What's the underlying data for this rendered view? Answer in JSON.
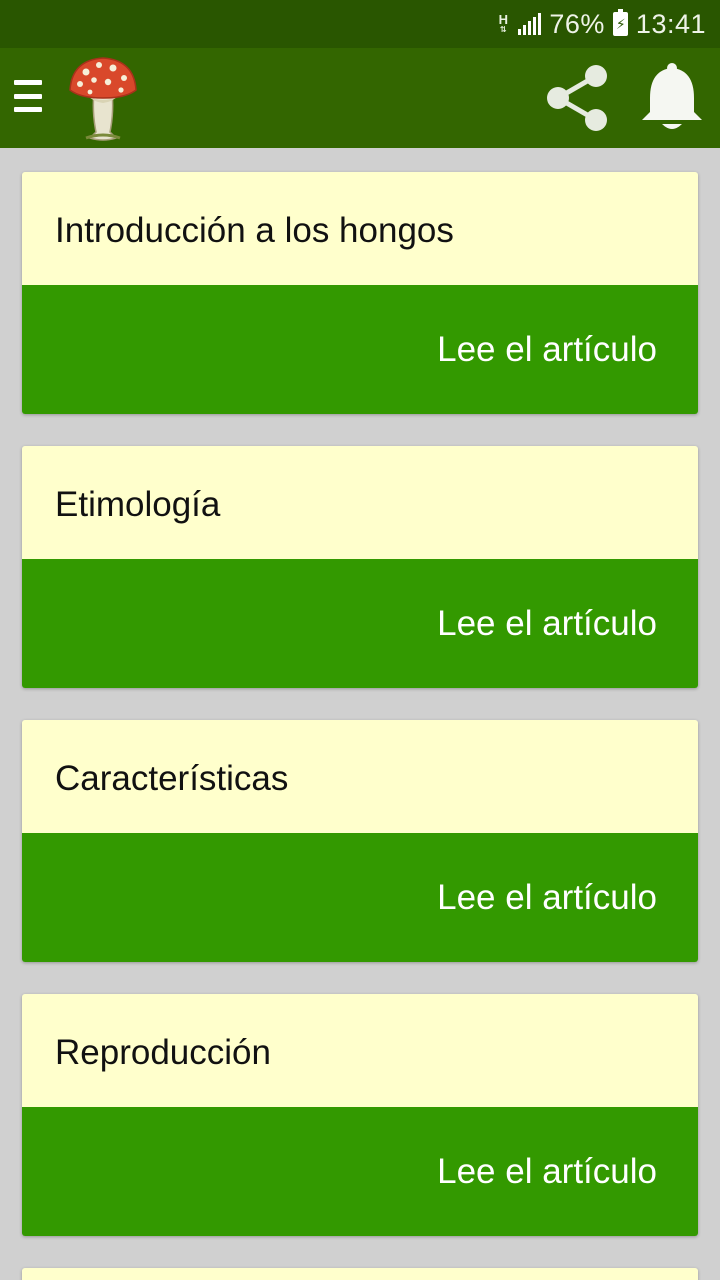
{
  "status_bar": {
    "network": "H",
    "battery_percent": "76%",
    "time": "13:41",
    "icons": [
      "network-type-icon",
      "signal-icon",
      "battery-charging-icon"
    ]
  },
  "app_bar": {
    "icons": [
      "menu-icon",
      "mushroom-logo-icon",
      "share-icon",
      "bell-icon"
    ],
    "colors": {
      "status_bar": "#295600",
      "toolbar": "#336600"
    }
  },
  "articles": [
    {
      "title": "Introducción a los hongos",
      "action": "Lee el artículo"
    },
    {
      "title": "Etimología",
      "action": "Lee el artículo"
    },
    {
      "title": "Características",
      "action": "Lee el artículo"
    },
    {
      "title": "Reproducción",
      "action": "Lee el artículo"
    }
  ],
  "colors": {
    "card_title_bg": "#ffffcc",
    "card_action_bg": "#339900",
    "page_bg": "#d0d0d0"
  }
}
